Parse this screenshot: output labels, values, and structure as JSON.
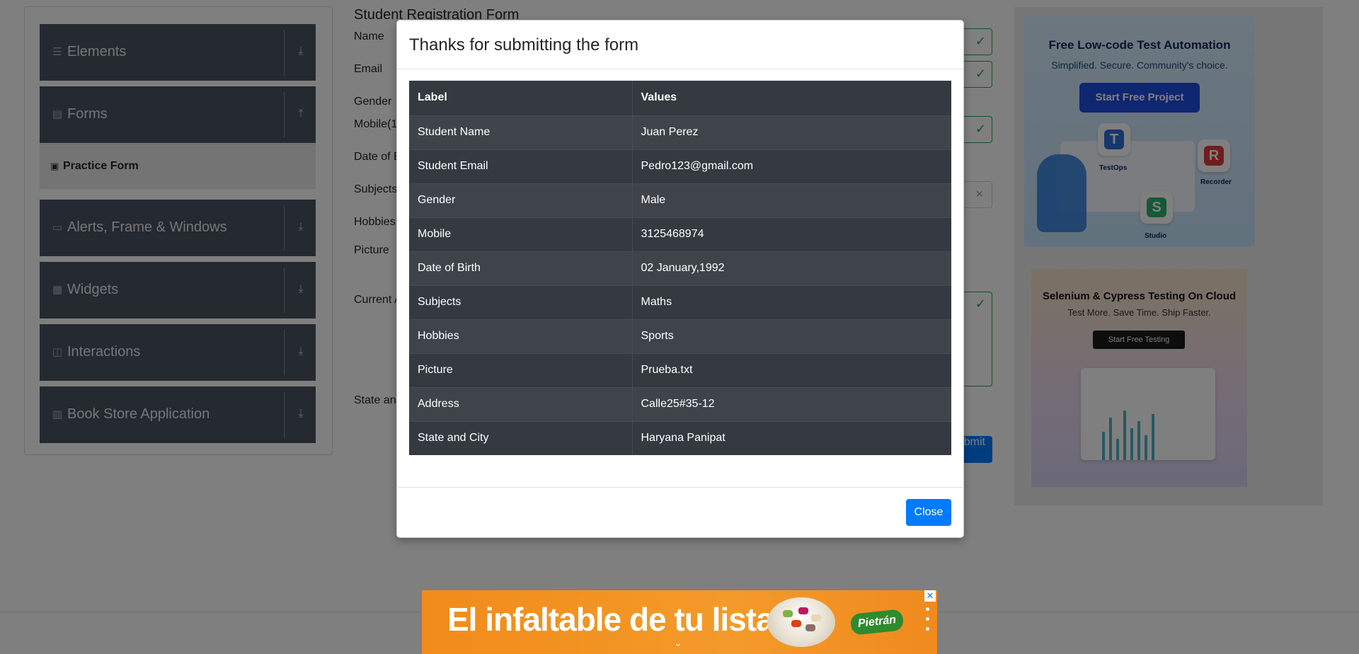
{
  "sidebar": {
    "groups": [
      {
        "label": "Elements",
        "icon": "hamburger-icon",
        "arrow": "download-arrow-icon"
      },
      {
        "label": "Forms",
        "icon": "document-icon",
        "arrow": "upload-arrow-icon"
      },
      {
        "label": "Alerts, Frame & Windows",
        "icon": "window-icon",
        "arrow": "download-arrow-icon"
      },
      {
        "label": "Widgets",
        "icon": "widgets-icon",
        "arrow": "download-arrow-icon"
      },
      {
        "label": "Interactions",
        "icon": "interactions-icon",
        "arrow": "download-arrow-icon"
      },
      {
        "label": "Book Store Application",
        "icon": "books-icon",
        "arrow": "download-arrow-icon"
      }
    ],
    "active_item": {
      "label": "Practice Form",
      "icon": "html5-icon"
    }
  },
  "form": {
    "title": "Student Registration Form",
    "labels": {
      "name": "Name",
      "email": "Email",
      "gender": "Gender",
      "mobile": "Mobile(1",
      "dob": "Date of B",
      "subjects": "Subjects",
      "hobbies": "Hobbies",
      "picture": "Picture",
      "address": "Current A",
      "state": "State and"
    },
    "submit_label": "Submit"
  },
  "ads": {
    "right_top": {
      "title": "Free Low-code Test Automation",
      "subtitle": "Simplified. Secure. Community's choice.",
      "button": "Start Free Project",
      "products": [
        "TestOps",
        "Recorder",
        "Studio"
      ]
    },
    "right_bottom": {
      "title": "Selenium & Cypress Testing On Cloud",
      "subtitle": "Test More. Save Time. Ship Faster.",
      "button": "Start Free Testing"
    },
    "bottom_banner": {
      "slogan": "El infaltable de tu lista",
      "brand": "Pietrán",
      "close_glyph": "✕"
    }
  },
  "modal": {
    "title": "Thanks for submitting the form",
    "table": {
      "headers": [
        "Label",
        "Values"
      ],
      "rows": [
        [
          "Student Name",
          "Juan Perez"
        ],
        [
          "Student Email",
          "Pedro123@gmail.com"
        ],
        [
          "Gender",
          "Male"
        ],
        [
          "Mobile",
          "3125468974"
        ],
        [
          "Date of Birth",
          "02 January,1992"
        ],
        [
          "Subjects",
          "Maths"
        ],
        [
          "Hobbies",
          "Sports"
        ],
        [
          "Picture",
          "Prueba.txt"
        ],
        [
          "Address",
          "Calle25#35-12"
        ],
        [
          "State and City",
          "Haryana Panipat"
        ]
      ]
    },
    "close_label": "Close"
  },
  "colors": {
    "overlay": "#000000",
    "primary": "#007bff",
    "table_dark": "#343a40",
    "sidebar_group": "#4a5360",
    "valid": "#28a745",
    "banner_orange": "#f28b1a"
  }
}
